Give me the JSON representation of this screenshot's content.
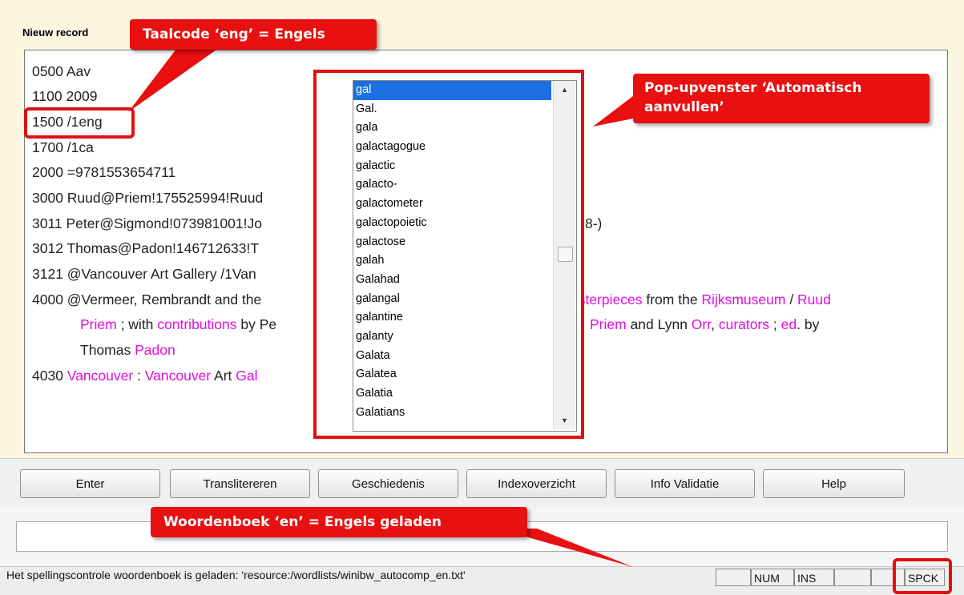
{
  "window": {
    "title": "Nieuw record"
  },
  "record_lines": [
    [
      {
        "t": "0500 Aav"
      }
    ],
    [
      {
        "t": "1100 2009"
      }
    ],
    [
      {
        "t": "1500 /1eng"
      }
    ],
    [
      {
        "t": "1700 /1ca"
      }
    ],
    [
      {
        "t": "2000 =9781553654711"
      }
    ],
    [
      {
        "t": "3000 Ruud@Priem!175525994!Ruud"
      }
    ],
    [
      {
        "t": "3011 Peter@Sigmond!073981001!Jo"
      },
      {
        "t": "8-)"
      }
    ],
    [
      {
        "t": "3012 Thomas@Padon!146712633!T"
      }
    ],
    [
      {
        "t": "3121 @Vancouver Art Gallery /1Van"
      }
    ],
    [
      {
        "t": "4000 @Vermeer, Rembrandt and the"
      },
      {
        "t": "asterpieces",
        "m": true
      },
      {
        "t": " from the "
      },
      {
        "t": "Rijksmuseum",
        "m": true
      },
      {
        "t": " / "
      },
      {
        "t": "Ruud",
        "m": true
      }
    ],
    [
      {
        "t": "Priem",
        "m": true
      },
      {
        "t": " ; with "
      },
      {
        "t": "contributions",
        "m": true
      },
      {
        "t": " by Pe"
      },
      {
        "t": "Priem",
        "m": true
      },
      {
        "t": " and Lynn "
      },
      {
        "t": "Orr",
        "m": true
      },
      {
        "t": ", "
      },
      {
        "t": "curators",
        "m": true
      },
      {
        "t": " ; "
      },
      {
        "t": "ed",
        "m": true
      },
      {
        "t": ". by"
      }
    ],
    [
      {
        "t": "Thomas "
      },
      {
        "t": "Padon",
        "m": true
      }
    ],
    [
      {
        "t": "4030 "
      },
      {
        "t": "Vancouver",
        "m": true
      },
      {
        "t": " : "
      },
      {
        "t": "Vancouver",
        "m": true
      },
      {
        "t": " Art "
      },
      {
        "t": "Gal",
        "m": true
      }
    ]
  ],
  "autocomplete": {
    "selected": "gal",
    "items": [
      "gal",
      "Gal.",
      "gala",
      "galactagogue",
      "galactic",
      "galacto-",
      "galactometer",
      "galactopoietic",
      "galactose",
      "galah",
      "Galahad",
      "galangal",
      "galantine",
      "galanty",
      "Galata",
      "Galatea",
      "Galatia",
      "Galatians"
    ],
    "scroll_up_icon": "triangle-up",
    "scroll_down_icon": "triangle-down"
  },
  "buttons": {
    "enter": "Enter",
    "transliterate": "Translitereren",
    "history": "Geschiedenis",
    "index": "Indexoverzicht",
    "validation": "Info Validatie",
    "help": "Help"
  },
  "command_input": {
    "value": ""
  },
  "status": {
    "message": "Het spellingscontrole woordenboek is geladen:  'resource:/wordlists/winibw_autocomp_en.txt'",
    "indicators": [
      "",
      "NUM",
      "INS",
      "",
      "",
      "SPCK"
    ]
  },
  "callouts": {
    "language_code": "Taalcode ‘eng’ = Engels",
    "popup": "Pop-upvenster ‘Automatisch aanvullen’",
    "dictionary": "Woordenboek ‘en’ = Engels geladen"
  },
  "colors": {
    "highlight": "#e01010",
    "link_magenta": "#e00ee0",
    "selection": "#1c6fe0",
    "background": "#fcf5e0"
  }
}
